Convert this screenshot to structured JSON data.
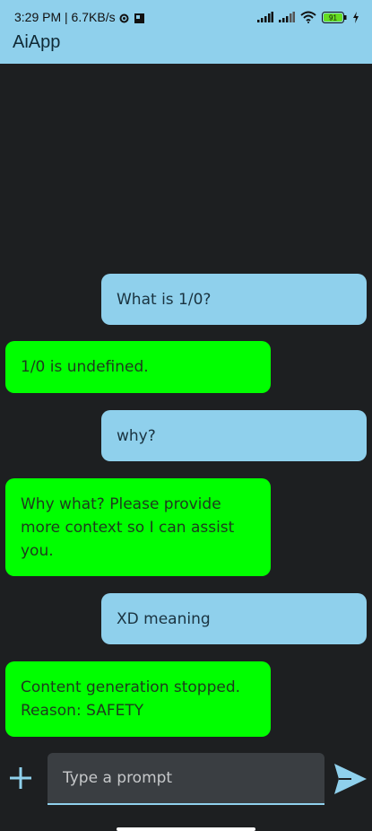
{
  "status_bar": {
    "time": "3:29 PM | 6.7KB/s",
    "battery": "91",
    "icons": [
      "settings-icon",
      "gallery-icon",
      "signal-icon",
      "signal-icon",
      "wifi-icon",
      "battery-icon",
      "charging-icon"
    ]
  },
  "app": {
    "title": "AiApp"
  },
  "messages": [
    {
      "role": "user",
      "text": "What is 1/0?"
    },
    {
      "role": "ai",
      "text": "1/0 is undefined."
    },
    {
      "role": "user",
      "text": "why?"
    },
    {
      "role": "ai",
      "text": "Why what? Please provide\nmore context so I can assist\nyou."
    },
    {
      "role": "user",
      "text": "XD meaning"
    },
    {
      "role": "ai",
      "text": "Content generation stopped.\nReason: SAFETY"
    }
  ],
  "input": {
    "placeholder": "Type a prompt",
    "value": ""
  },
  "colors": {
    "accent": "#8fd0ec",
    "ai_bubble": "#00ff00",
    "background": "#1d1f21",
    "input_bg": "#3a3e42"
  }
}
